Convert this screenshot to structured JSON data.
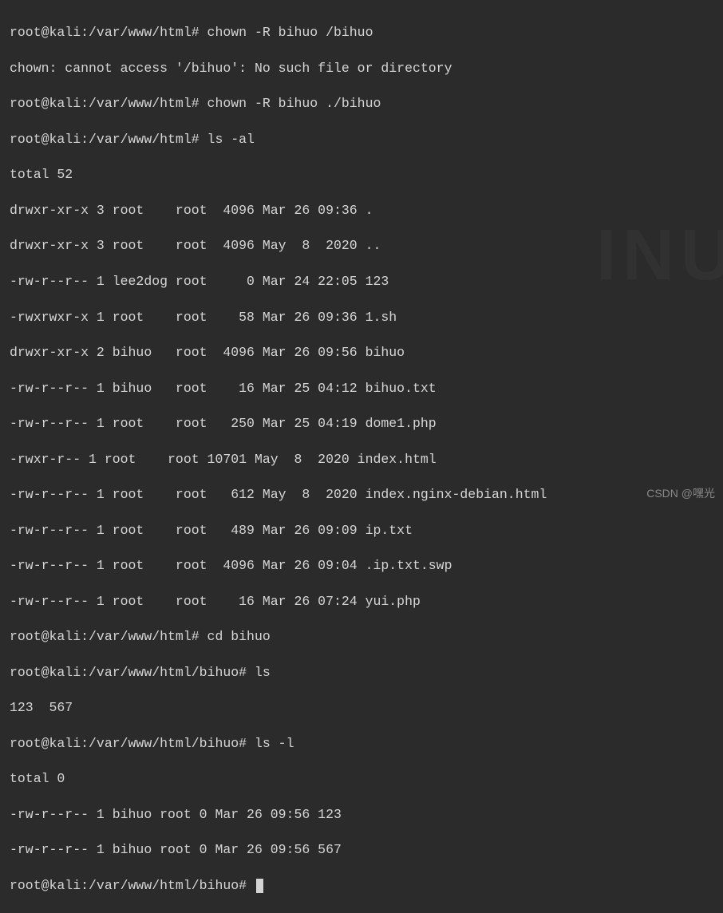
{
  "prompt1": "root@kali:/var/www/html#",
  "prompt2": "root@kali:/var/www/html/bihuo#",
  "lines": {
    "l1_cmd": "chown -R bihuo /bihuo",
    "l2": "chown: cannot access '/bihuo': No such file or directory",
    "l3_cmd": "chown -R bihuo ./bihuo",
    "l4_cmd": "ls -al",
    "l5": "total 52",
    "l6": "drwxr-xr-x 3 root    root  4096 Mar 26 09:36 .",
    "l7": "drwxr-xr-x 3 root    root  4096 May  8  2020 ..",
    "l8": "-rw-r--r-- 1 lee2dog root     0 Mar 24 22:05 123",
    "l9": "-rwxrwxr-x 1 root    root    58 Mar 26 09:36 1.sh",
    "l10": "drwxr-xr-x 2 bihuo   root  4096 Mar 26 09:56 bihuo",
    "l11": "-rw-r--r-- 1 bihuo   root    16 Mar 25 04:12 bihuo.txt",
    "l12": "-rw-r--r-- 1 root    root   250 Mar 25 04:19 dome1.php",
    "l13": "-rwxr-r-- 1 root    root 10701 May  8  2020 index.html",
    "l14": "-rw-r--r-- 1 root    root   612 May  8  2020 index.nginx-debian.html",
    "l15": "-rw-r--r-- 1 root    root   489 Mar 26 09:09 ip.txt",
    "l16": "-rw-r--r-- 1 root    root  4096 Mar 26 09:04 .ip.txt.swp",
    "l17": "-rw-r--r-- 1 root    root    16 Mar 26 07:24 yui.php",
    "l18_cmd": "cd bihuo",
    "l19_cmd": "ls",
    "l20": "123  567",
    "l21_cmd": "ls -l",
    "l22": "total 0",
    "l23": "-rw-r--r-- 1 bihuo root 0 Mar 26 09:56 123",
    "l24": "-rw-r--r-- 1 bihuo root 0 Mar 26 09:56 567"
  },
  "watermark": "CSDN @嘿光",
  "bg_watermark": "INU"
}
